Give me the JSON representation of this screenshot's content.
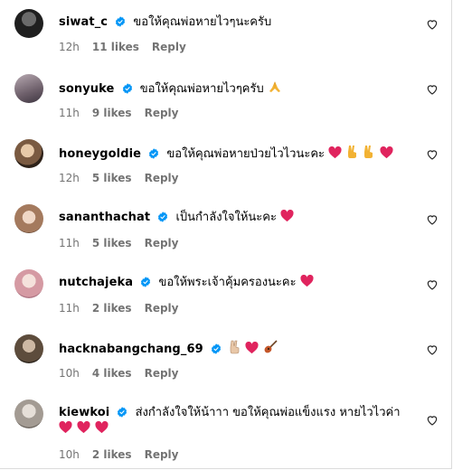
{
  "comments": [
    {
      "username": "siwat_c",
      "text": "ขอให้คุณพ่อหายไวๆนะครับ",
      "time": "12h",
      "likes": "11 likes",
      "reply": "Reply",
      "avatar_color": "#2a2a2a",
      "emoji": []
    },
    {
      "username": "sonyuke",
      "text": "ขอให้คุณพ่อหายไวๆครับ",
      "time": "11h",
      "likes": "9 likes",
      "reply": "Reply",
      "avatar_color": "#8a7a86",
      "emoji": [
        "folded-hands"
      ]
    },
    {
      "username": "honeygoldie",
      "text": "ขอให้คุณพ่อหายป่วยไวไวนะคะ",
      "time": "12h",
      "likes": "5 likes",
      "reply": "Reply",
      "avatar_color": "#6b4f3a",
      "emoji": [
        "heart",
        "victory-hand",
        "victory-hand",
        "heart"
      ]
    },
    {
      "username": "sananthachat",
      "text": "เป็นกำลังใจให้นะคะ",
      "time": "11h",
      "likes": "5 likes",
      "reply": "Reply",
      "avatar_color": "#c9a690",
      "emoji": [
        "heart"
      ]
    },
    {
      "username": "nutchajeka",
      "text": "ขอให้พระเจ้าคุ้มครองนะคะ",
      "time": "11h",
      "likes": "2 likes",
      "reply": "Reply",
      "avatar_color": "#e6c4c6",
      "emoji": [
        "heart"
      ]
    },
    {
      "username": "hacknabangchang_69",
      "text": "",
      "time": "10h",
      "likes": "4 likes",
      "reply": "Reply",
      "avatar_color": "#4a4036",
      "emoji": [
        "victory-hand",
        "heart",
        "guitar"
      ]
    },
    {
      "username": "kiewkoi",
      "text": "ส่งกำลังใจให้น้าาา ขอให้คุณพ่อแข็งแรง หายไวไวค่า",
      "time": "10h",
      "likes": "2 likes",
      "reply": "Reply",
      "avatar_color": "#b7b0a8",
      "emoji": [
        "heart",
        "heart",
        "heart"
      ]
    }
  ],
  "colors": {
    "verified": "#0095f6",
    "meta": "#737373",
    "heart_emoji": "#e0245e"
  },
  "icons": {
    "verified": "verified-badge-icon",
    "like": "heart-outline-icon"
  }
}
